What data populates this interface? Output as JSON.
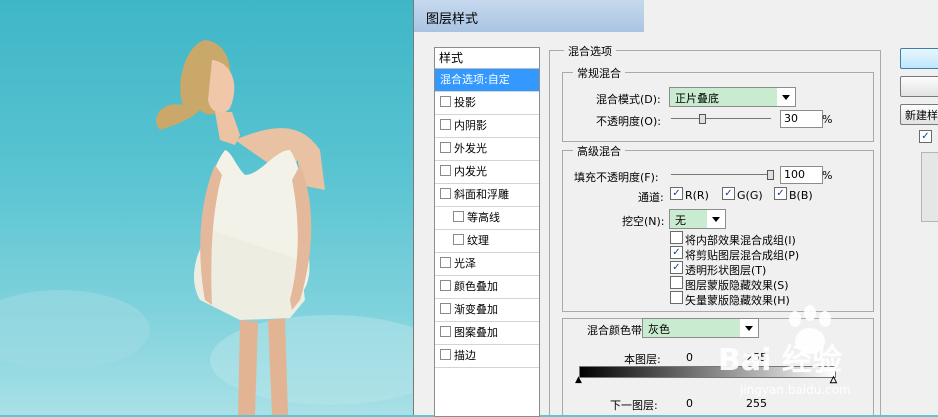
{
  "dialog": {
    "title": "图层样式"
  },
  "style_list": {
    "header": "样式",
    "items": [
      {
        "label": "混合选项:自定",
        "selected": true,
        "checkbox": false,
        "indent": false
      },
      {
        "label": "投影",
        "checkbox": true,
        "indent": false
      },
      {
        "label": "内阴影",
        "checkbox": true,
        "indent": false
      },
      {
        "label": "外发光",
        "checkbox": true,
        "indent": false
      },
      {
        "label": "内发光",
        "checkbox": true,
        "indent": false
      },
      {
        "label": "斜面和浮雕",
        "checkbox": true,
        "indent": false
      },
      {
        "label": "等高线",
        "checkbox": true,
        "indent": true
      },
      {
        "label": "纹理",
        "checkbox": true,
        "indent": true
      },
      {
        "label": "光泽",
        "checkbox": true,
        "indent": false
      },
      {
        "label": "颜色叠加",
        "checkbox": true,
        "indent": false
      },
      {
        "label": "渐变叠加",
        "checkbox": true,
        "indent": false
      },
      {
        "label": "图案叠加",
        "checkbox": true,
        "indent": false
      },
      {
        "label": "描边",
        "checkbox": true,
        "indent": false
      }
    ]
  },
  "blend_options": {
    "section_title": "混合选项",
    "general": {
      "title": "常规混合",
      "mode_label": "混合模式(D):",
      "mode_value": "正片叠底",
      "opacity_label": "不透明度(O):",
      "opacity_value": "30",
      "opacity_unit": "%"
    },
    "advanced": {
      "title": "高级混合",
      "fill_label": "填充不透明度(F):",
      "fill_value": "100",
      "fill_unit": "%",
      "channels_label": "通道:",
      "channel_r": "R(R)",
      "channel_g": "G(G)",
      "channel_b": "B(B)",
      "knockout_label": "挖空(N):",
      "knockout_value": "无",
      "options": [
        {
          "label": "将内部效果混合成组(I)",
          "checked": false
        },
        {
          "label": "将剪贴图层混合成组(P)",
          "checked": true
        },
        {
          "label": "透明形状图层(T)",
          "checked": true
        },
        {
          "label": "图层蒙版隐藏效果(S)",
          "checked": false
        },
        {
          "label": "矢量蒙版隐藏效果(H)",
          "checked": false
        }
      ]
    },
    "blend_if": {
      "label": "混合颜色带(E):",
      "value": "灰色",
      "this_layer_label": "本图层:",
      "this_layer_min": "0",
      "this_layer_max": "255",
      "underlying_label": "下一图层:",
      "underlying_min": "0",
      "underlying_max": "255"
    }
  },
  "right_panel": {
    "new_style_button": "新建样"
  },
  "watermark": {
    "brand": "Bai 经验",
    "url": "jingyan.baidu.com"
  },
  "colors": {
    "selection": "#3399ff",
    "dropdown_bg": "#c9ecd1",
    "sky": "#58c3d1"
  }
}
